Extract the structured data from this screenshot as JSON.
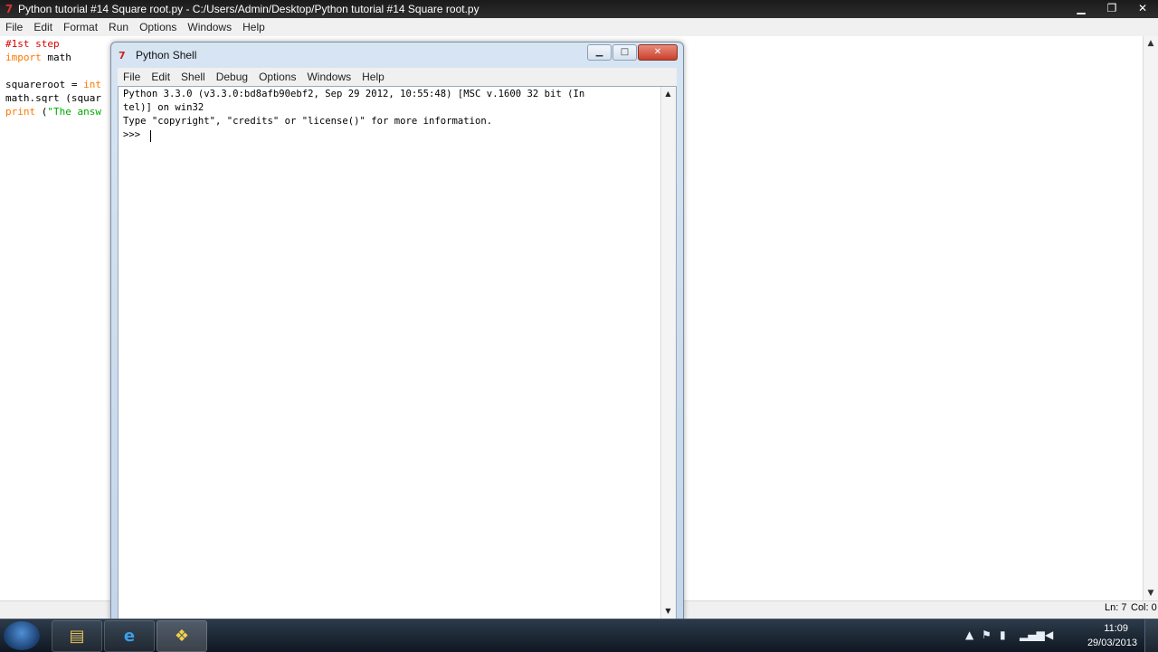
{
  "editor": {
    "title": "Python tutorial #14 Square root.py - C:/Users/Admin/Desktop/Python tutorial #14 Square root.py",
    "menu": [
      "File",
      "Edit",
      "Format",
      "Run",
      "Options",
      "Windows",
      "Help"
    ],
    "code": {
      "line1": "#1st step",
      "line2_kw": "import",
      "line2_rest": " math",
      "line4_a": "squareroot = ",
      "line4_b": "int",
      "line5": "math.sqrt (squar",
      "line6_a": "print",
      "line6_b": " (",
      "line6_c": "\"The answ"
    },
    "status": {
      "ln": "Ln: 7",
      "col": "Col: 0"
    }
  },
  "shell": {
    "title": "Python Shell",
    "menu": [
      "File",
      "Edit",
      "Shell",
      "Debug",
      "Options",
      "Windows",
      "Help"
    ],
    "lines": [
      "Python 3.3.0 (v3.3.0:bd8afb90ebf2, Sep 29 2012, 10:55:48) [MSC v.1600 32 bit (In",
      "tel)] on win32",
      "Type \"copyright\", \"credits\" or \"license()\" for more information.",
      ">>> "
    ]
  },
  "taskbar": {
    "items": [
      {
        "name": "explorer",
        "icon": "folder-icon"
      },
      {
        "name": "internet-explorer",
        "icon": "internet-explorer-icon"
      },
      {
        "name": "python",
        "icon": "python-icon"
      }
    ],
    "clock": {
      "time": "11:09",
      "date": "29/03/2013"
    }
  },
  "colors": {
    "comment": "#dd0000",
    "keyword": "#ff7700",
    "string": "#00aa00"
  }
}
